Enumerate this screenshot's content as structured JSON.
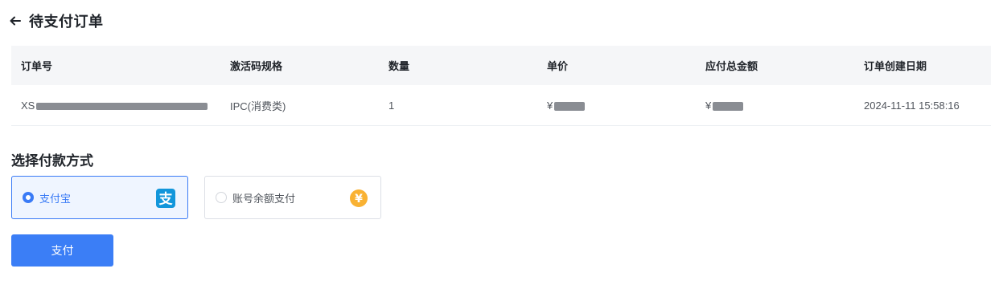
{
  "header": {
    "title": "待支付订单",
    "back_icon": "arrow-left-icon"
  },
  "order_table": {
    "columns": [
      "订单号",
      "激活码规格",
      "数量",
      "单价",
      "应付总金额",
      "订单创建日期"
    ],
    "rows": [
      {
        "order_no_prefix": "XS",
        "spec": "IPC(消费类)",
        "quantity": "1",
        "unit_price_prefix": "¥",
        "total_prefix": "¥",
        "created_at": "2024-11-11 15:58:16"
      }
    ]
  },
  "payment": {
    "section_title": "选择付款方式",
    "options": [
      {
        "label": "支付宝",
        "icon": "alipay-icon",
        "selected": true
      },
      {
        "label": "账号余额支付",
        "icon": "yuan-coin-icon",
        "selected": false
      }
    ],
    "pay_button_label": "支付"
  },
  "colors": {
    "accent": "#3b7ef6",
    "alipay_blue": "#1296db",
    "coin_orange": "#f9b233",
    "header_bg": "#f5f6f8"
  }
}
